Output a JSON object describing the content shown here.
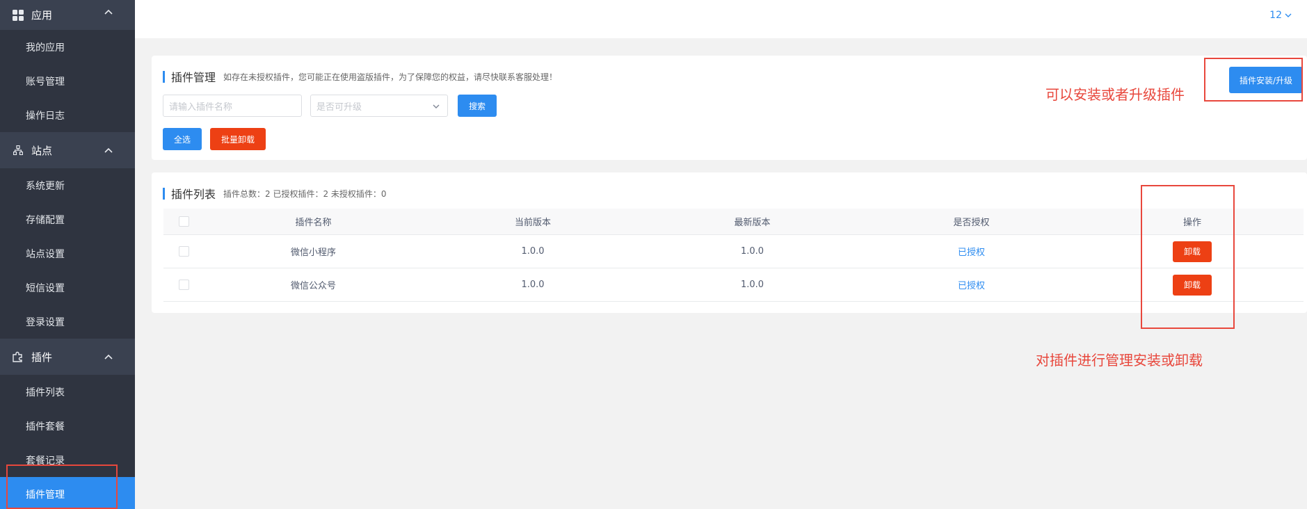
{
  "sidebar": {
    "groups": [
      {
        "title": "应用",
        "icon": "grid-icon",
        "items": [
          {
            "label": "我的应用"
          },
          {
            "label": "账号管理"
          },
          {
            "label": "操作日志"
          }
        ]
      },
      {
        "title": "站点",
        "icon": "sitemap-icon",
        "items": [
          {
            "label": "系统更新"
          },
          {
            "label": "存储配置"
          },
          {
            "label": "站点设置"
          },
          {
            "label": "短信设置"
          },
          {
            "label": "登录设置"
          }
        ]
      },
      {
        "title": "插件",
        "icon": "puzzle-icon",
        "items": [
          {
            "label": "插件列表"
          },
          {
            "label": "插件套餐"
          },
          {
            "label": "套餐记录"
          },
          {
            "label": "插件管理",
            "active": true
          }
        ]
      }
    ]
  },
  "topbar": {
    "user": "12"
  },
  "manage": {
    "title": "插件管理",
    "tip": "如存在未授权插件，您可能正在使用盗版插件，为了保障您的权益，请尽快联系客服处理！",
    "search_placeholder": "请输入插件名称",
    "upgrade_placeholder": "是否可升级",
    "search_button": "搜索",
    "select_all_button": "全选",
    "batch_uninstall_button": "批量卸载",
    "install_button": "插件安装/升级"
  },
  "list": {
    "title": "插件列表",
    "stats": "插件总数：2 已授权插件：2 未授权插件：0",
    "columns": [
      "插件名称",
      "当前版本",
      "最新版本",
      "是否授权",
      "操作"
    ],
    "rows": [
      {
        "name": "微信小程序",
        "current": "1.0.0",
        "latest": "1.0.0",
        "auth": "已授权",
        "action": "卸载"
      },
      {
        "name": "微信公众号",
        "current": "1.0.0",
        "latest": "1.0.0",
        "auth": "已授权",
        "action": "卸载"
      }
    ]
  },
  "annotations": {
    "install_note": "可以安装或者升级插件",
    "manage_note": "对插件进行管理安装或卸载"
  },
  "colors": {
    "accent": "#2d8cf0",
    "danger": "#ed4014",
    "sidebar": "#2f3440",
    "annotation": "#e8473c"
  }
}
